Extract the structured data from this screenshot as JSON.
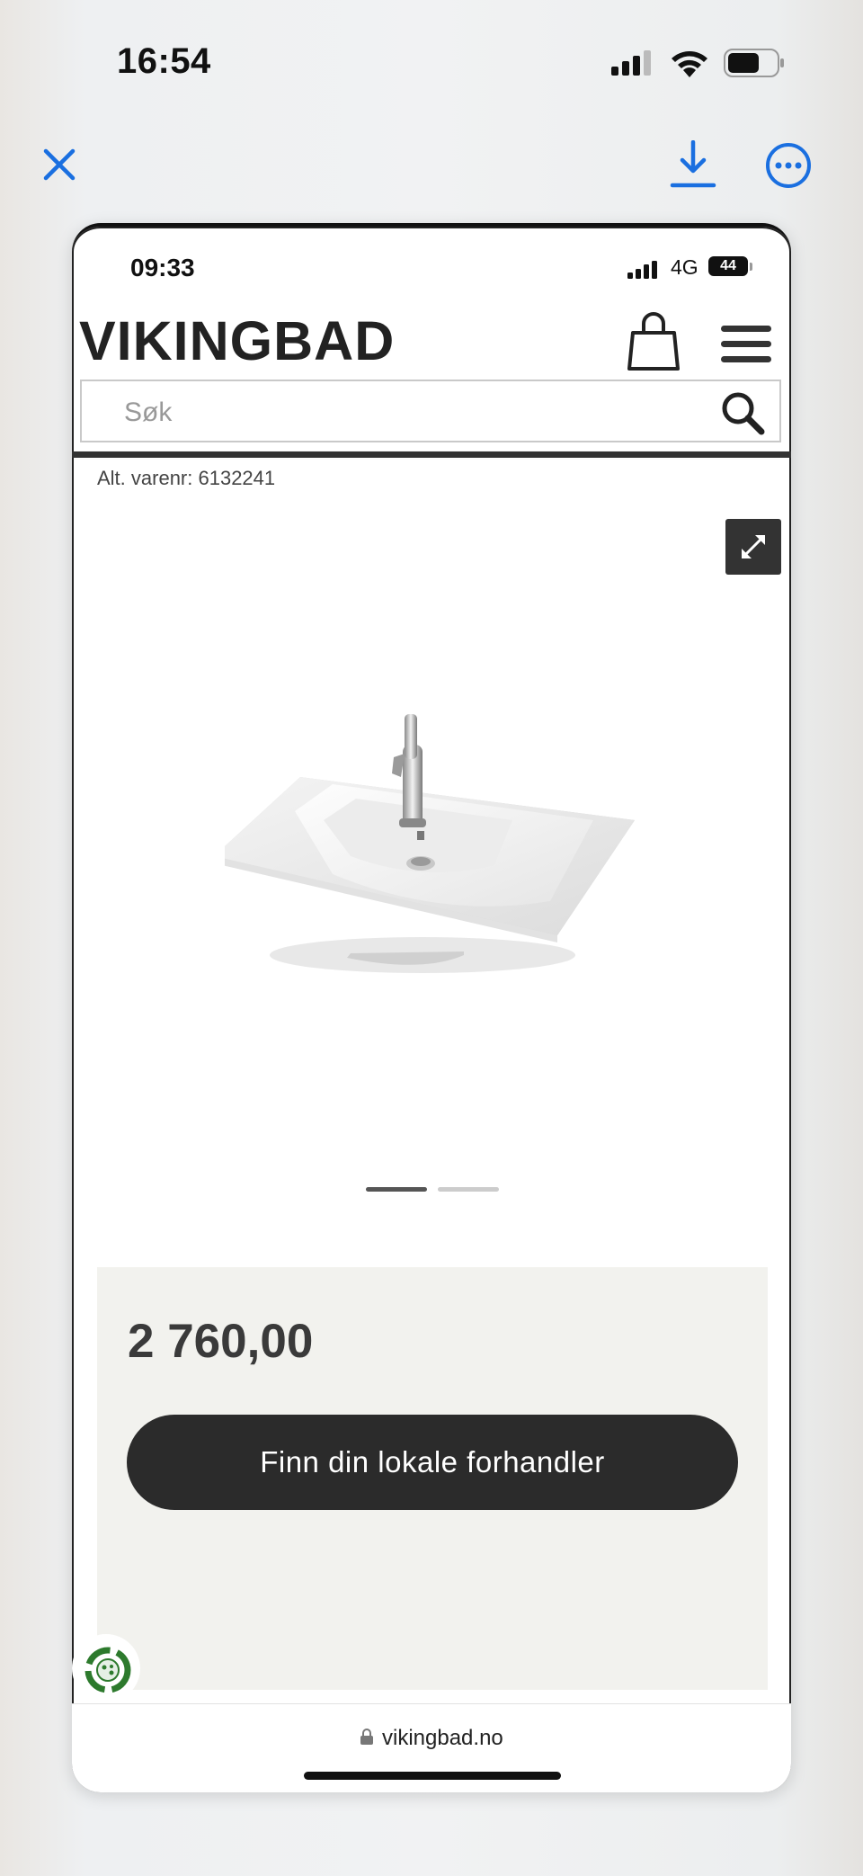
{
  "os_status": {
    "time": "16:54"
  },
  "viewer": {
    "close_icon": "close-icon",
    "download_icon": "download-icon",
    "more_icon": "more-icon",
    "accent": "#1a6fe0"
  },
  "screenshot": {
    "status": {
      "time": "09:33",
      "network": "4G",
      "battery": "44"
    },
    "header": {
      "logo": "VIKINGBAD",
      "cart_icon": "shopping-bag-icon",
      "menu_icon": "hamburger-menu-icon"
    },
    "search": {
      "placeholder": "Søk",
      "icon": "search-icon"
    },
    "product": {
      "alt_nr": "Alt. varenr: 6132241",
      "gallery": {
        "slides": 2,
        "active": 1
      },
      "price": "2 760,00",
      "cta": "Finn din lokale forhandler"
    },
    "browser": {
      "url": "vikingbad.no"
    }
  }
}
